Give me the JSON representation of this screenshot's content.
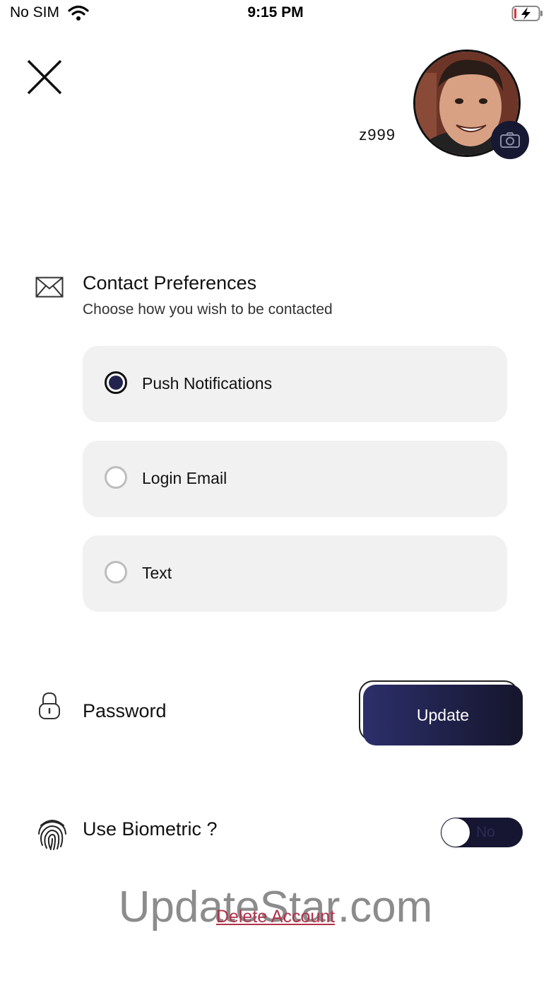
{
  "status_bar": {
    "carrier": "No SIM",
    "time": "9:15 PM"
  },
  "header": {
    "username": "z999"
  },
  "contact": {
    "title": "Contact Preferences",
    "subtitle": "Choose how you wish to be contacted",
    "options": [
      {
        "label": "Push Notifications",
        "selected": true
      },
      {
        "label": "Login Email",
        "selected": false
      },
      {
        "label": "Text",
        "selected": false
      }
    ]
  },
  "password": {
    "label": "Password",
    "button_label": "Update"
  },
  "biometric": {
    "label": "Use Biometric ?",
    "toggle_text": "No",
    "enabled": false
  },
  "footer": {
    "delete_label": "Delete Account",
    "watermark": "UpdateStar.com"
  },
  "colors": {
    "accent": "#23244d",
    "danger": "#b0314a",
    "option_bg": "#f1f1f1"
  }
}
